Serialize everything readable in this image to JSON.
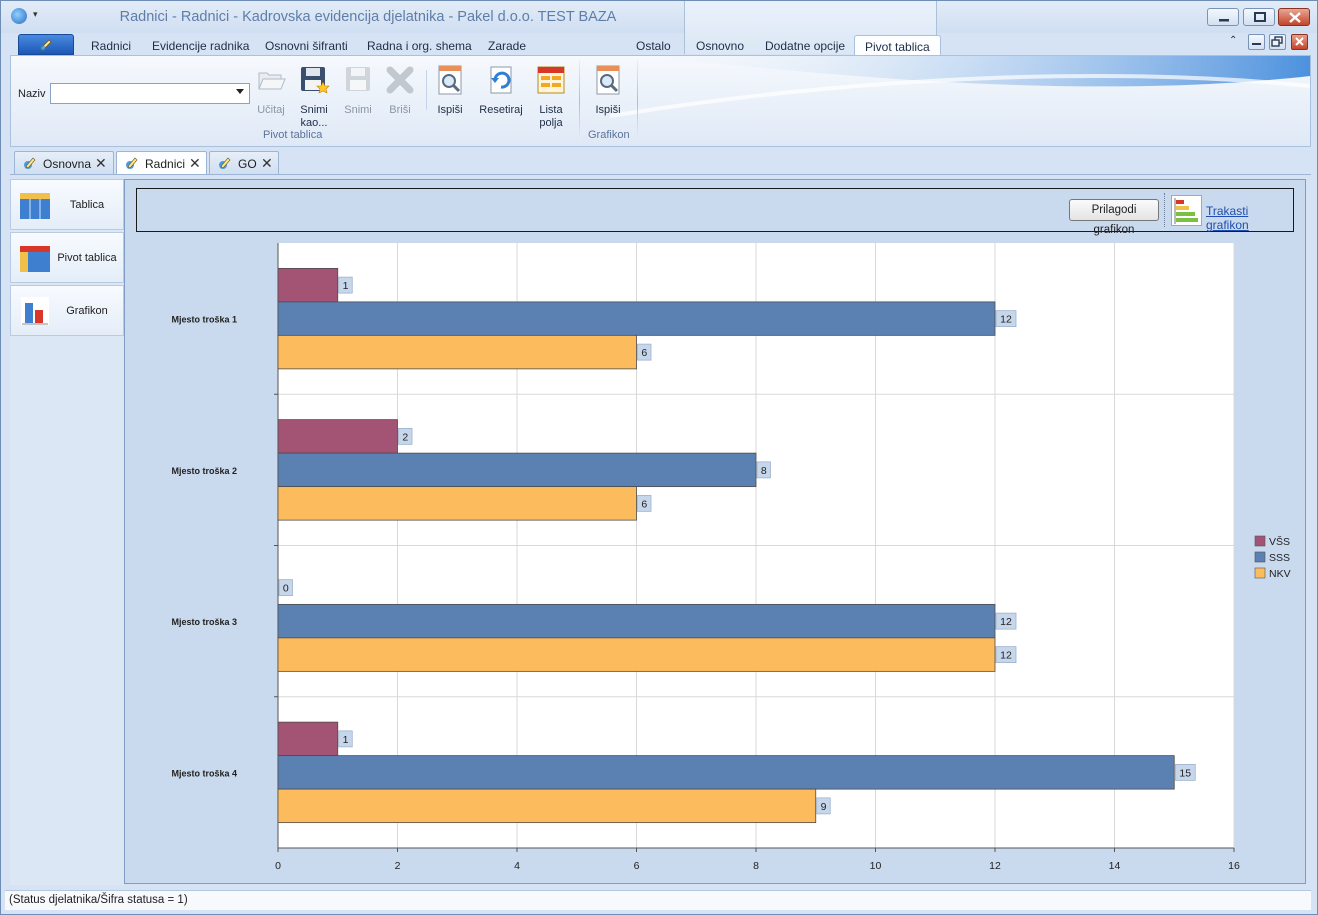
{
  "window": {
    "title": "Radnici - Radnici - Kadrovska evidencija djelatnika - Pakel d.o.o. TEST BAZA",
    "app_icon": "app-globe-icon",
    "quick_access": "▾"
  },
  "ribbon_tabs": [
    {
      "label": "Radnici"
    },
    {
      "label": "Evidencije radnika"
    },
    {
      "label": "Osnovni šifranti"
    },
    {
      "label": "Radna i org. shema"
    },
    {
      "label": "Zarade"
    },
    {
      "label": "Ostalo"
    },
    {
      "label": "Osnovno"
    },
    {
      "label": "Dodatne opcije"
    },
    {
      "label": "Pivot tablica"
    }
  ],
  "ribbon": {
    "naziv_label": "Naziv",
    "naziv_value": "",
    "buttons": [
      {
        "label": "Učitaj",
        "icon": "folder-open-icon",
        "enabled": false
      },
      {
        "label": "Snimi kao...",
        "icon": "save-as-icon",
        "enabled": true
      },
      {
        "label": "Snimi",
        "icon": "save-icon",
        "enabled": false
      },
      {
        "label": "Briši",
        "icon": "delete-x-icon",
        "enabled": false
      },
      {
        "label": "Ispiši",
        "icon": "print-preview-icon",
        "enabled": true
      },
      {
        "label": "Resetiraj",
        "icon": "reset-icon",
        "enabled": true
      },
      {
        "label": "Lista polja",
        "icon": "field-list-icon",
        "enabled": true
      },
      {
        "label": "Ispiši",
        "icon": "print-preview-icon",
        "enabled": true
      }
    ],
    "group_pivot": "Pivot tablica",
    "group_chart": "Grafikon"
  },
  "doc_tabs": [
    {
      "label": "Osnovna",
      "active": false
    },
    {
      "label": "Radnici",
      "active": true
    },
    {
      "label": "GO",
      "active": false
    }
  ],
  "left_nav": [
    {
      "label": "Tablica",
      "icon": "table-icon"
    },
    {
      "label": "Pivot tablica",
      "icon": "pivot-table-icon"
    },
    {
      "label": "Grafikon",
      "icon": "bar-chart-icon"
    }
  ],
  "chart_toolbar": {
    "customize": "Prilagodi grafikon",
    "chart_type": "Trakasti grafikon"
  },
  "status": "(Status djelatnika/Šifra statusa = 1)",
  "chart_data": {
    "type": "bar",
    "orientation": "horizontal",
    "categories": [
      "Mjesto troška 1",
      "Mjesto troška 2",
      "Mjesto troška 3",
      "Mjesto troška 4"
    ],
    "series": [
      {
        "name": "VŠS",
        "color": "#a35374",
        "values": [
          1,
          2,
          0,
          1
        ]
      },
      {
        "name": "SSS",
        "color": "#5b80b2",
        "values": [
          12,
          8,
          12,
          15
        ]
      },
      {
        "name": "NKV",
        "color": "#fcbc5d",
        "values": [
          6,
          6,
          12,
          9
        ]
      }
    ],
    "xlim": [
      0,
      16
    ],
    "x_ticks": [
      0,
      2,
      4,
      6,
      8,
      10,
      12,
      14,
      16
    ],
    "grid": true,
    "data_labels": true,
    "legend": "right"
  }
}
